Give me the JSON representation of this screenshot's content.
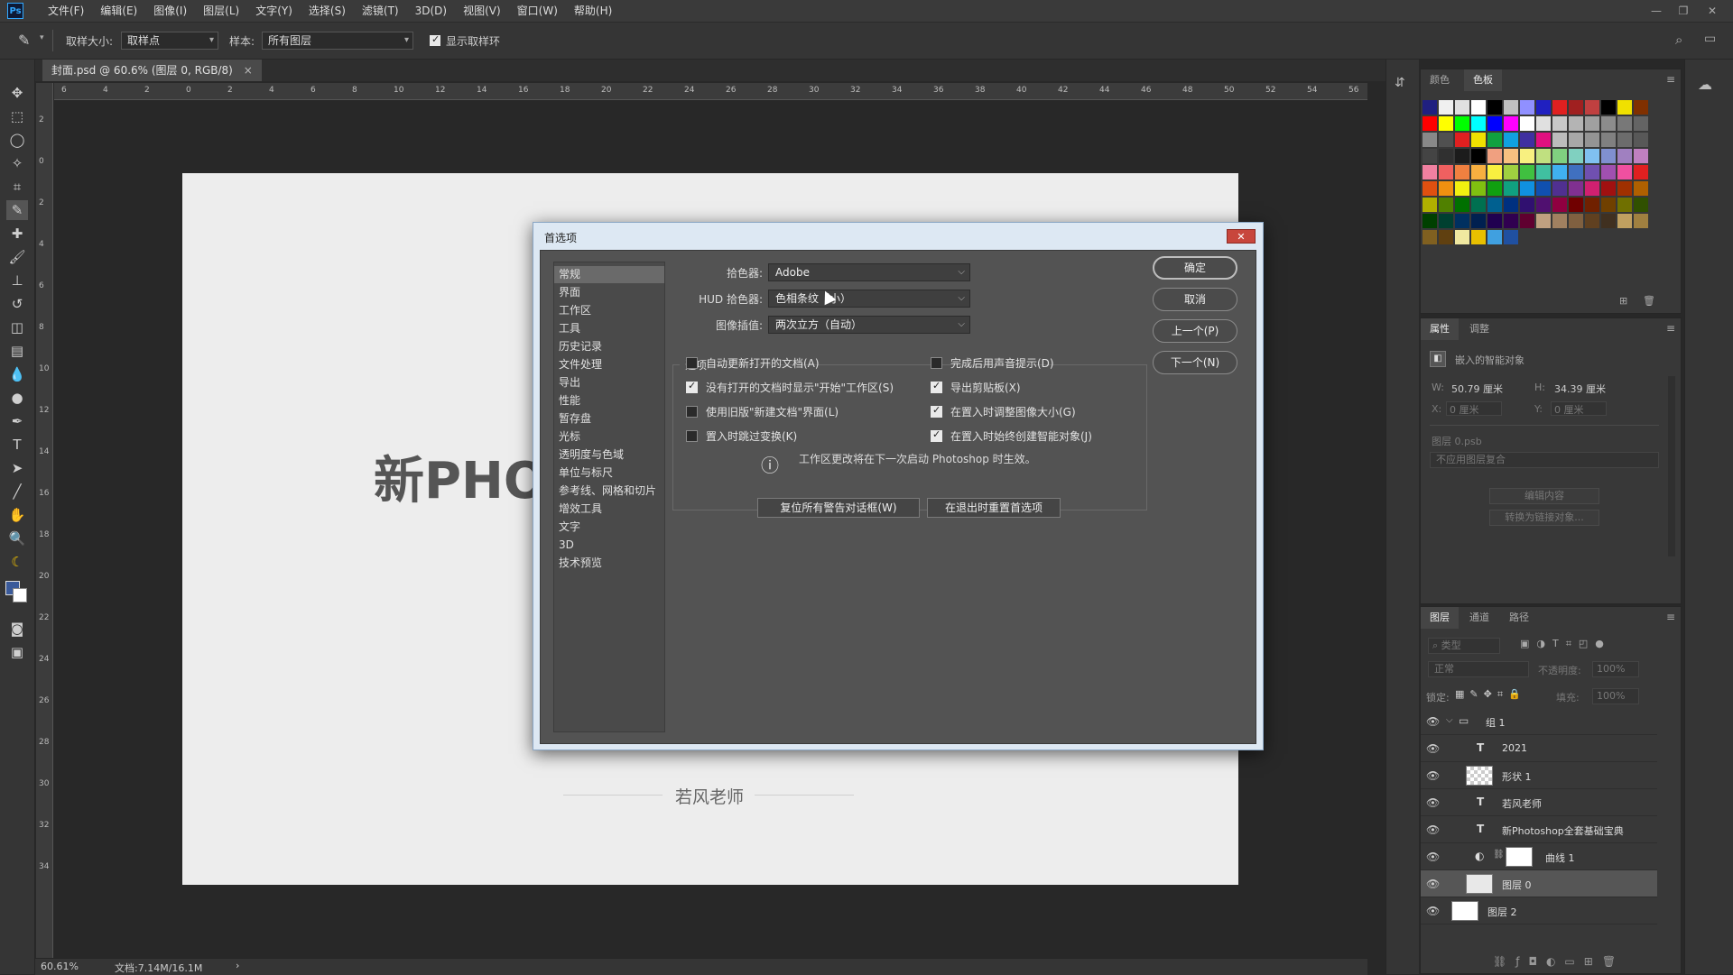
{
  "app": {
    "logo": "Ps",
    "menus": [
      "文件(F)",
      "编辑(E)",
      "图像(I)",
      "图层(L)",
      "文字(Y)",
      "选择(S)",
      "滤镜(T)",
      "3D(D)",
      "视图(V)",
      "窗口(W)",
      "帮助(H)"
    ],
    "window_controls": [
      "minimize-icon",
      "restore-icon",
      "close-icon"
    ]
  },
  "options_bar": {
    "sample_size_label": "取样大小:",
    "sample_size_value": "取样点",
    "sample_label": "样本:",
    "sample_value": "所有图层",
    "show_ring_label": "显示取样环",
    "show_ring_checked": true
  },
  "document": {
    "tab_title": "封面.psd @ 60.6% (图层 0, RGB/8)",
    "tab_close": "×",
    "big_text": "新PHO",
    "signature": "若风老师",
    "hruler_ticks": [
      "6",
      "4",
      "2",
      "0",
      "2",
      "4",
      "6",
      "8",
      "10",
      "12",
      "14",
      "16",
      "18",
      "20",
      "22",
      "24",
      "26",
      "28",
      "30",
      "32",
      "34",
      "36",
      "38",
      "40",
      "42",
      "44",
      "46",
      "48",
      "50",
      "52",
      "54",
      "56"
    ],
    "vruler_ticks": [
      "2",
      "0",
      "2",
      "4",
      "6",
      "8",
      "10",
      "12",
      "14",
      "16",
      "18",
      "20",
      "22",
      "24",
      "26",
      "28",
      "30",
      "32",
      "34"
    ]
  },
  "status": {
    "zoom": "60.61%",
    "doc_info": "文档:7.14M/16.1M",
    "arrow": "›"
  },
  "dialog": {
    "title": "首选项",
    "close": "✕",
    "categories": [
      "常规",
      "界面",
      "工作区",
      "工具",
      "历史记录",
      "文件处理",
      "导出",
      "性能",
      "暂存盘",
      "光标",
      "透明度与色域",
      "单位与标尺",
      "参考线、网格和切片",
      "增效工具",
      "文字",
      "3D",
      "技术预览"
    ],
    "selected_category": "常规",
    "color_picker_label": "拾色器:",
    "color_picker_value": "Adobe",
    "hud_label": "HUD 拾色器:",
    "hud_value": "色相条纹（小）",
    "interp_label": "图像插值:",
    "interp_value": "两次立方（自动）",
    "options_legend": "选项",
    "options": [
      {
        "label": "自动更新打开的文档(A)",
        "checked": false
      },
      {
        "label": "完成后用声音提示(D)",
        "checked": false
      },
      {
        "label": "没有打开的文档时显示\"开始\"工作区(S)",
        "checked": true
      },
      {
        "label": "导出剪贴板(X)",
        "checked": true
      },
      {
        "label": "使用旧版\"新建文档\"界面(L)",
        "checked": false
      },
      {
        "label": "在置入时调整图像大小(G)",
        "checked": true
      },
      {
        "label": "置入时跳过变换(K)",
        "checked": false
      },
      {
        "label": "在置入时始终创建智能对象(J)",
        "checked": true
      }
    ],
    "info_icon": "ⓘ",
    "info_text": "工作区更改将在下一次启动 Photoshop 时生效。",
    "reset_warnings": "复位所有警告对话框(W)",
    "reset_prefs": "在退出时重置首选项",
    "ok": "确定",
    "cancel": "取消",
    "prev": "上一个(P)",
    "next": "下一个(N)"
  },
  "swatches_panel": {
    "tabs": [
      "颜色",
      "色板"
    ],
    "active": "色板",
    "colors": [
      "#202080",
      "#f0f0f0",
      "#e0e0e0",
      "#ffffff",
      "#000000",
      "#c0c0c0",
      "#9090ff",
      "#2020c0",
      "#e02020",
      "#a02020",
      "#c04040",
      "#000000",
      "#f0e000",
      "#803000",
      "#ff0000",
      "#ffff00",
      "#00ff00",
      "#00ffff",
      "#0000ff",
      "#ff00ff",
      "#ffffff",
      "#e0e0e0",
      "#c8c8c8",
      "#b4b4b4",
      "#a0a0a0",
      "#8c8c8c",
      "#787878",
      "#646464",
      "#888888",
      "#505050",
      "#e02020",
      "#f0e000",
      "#10a040",
      "#10a0e0",
      "#4030a0",
      "#e01080",
      "#bcbcbc",
      "#a8a8a8",
      "#949494",
      "#808080",
      "#6c6c6c",
      "#585858",
      "#444444",
      "#303030",
      "#1c1c1c",
      "#000000",
      "#f0a080",
      "#f8c080",
      "#f8f080",
      "#c0e080",
      "#80d080",
      "#80d0c0",
      "#80c0f0",
      "#8090d0",
      "#a080c0",
      "#c080c0",
      "#f080a0",
      "#f06060",
      "#f08040",
      "#f8b040",
      "#f8f040",
      "#a0d040",
      "#40c040",
      "#40c0a0",
      "#40b0f0",
      "#4070c0",
      "#7050b0",
      "#a050b0",
      "#f050a0",
      "#e02020",
      "#e05010",
      "#f09010",
      "#f0f010",
      "#80c010",
      "#10a010",
      "#10a080",
      "#1090e0",
      "#1050b0",
      "#503090",
      "#803090",
      "#d02070",
      "#a01010",
      "#a03000",
      "#b06000",
      "#b0b000",
      "#508000",
      "#007000",
      "#007050",
      "#006090",
      "#003080",
      "#301070",
      "#501070",
      "#900040",
      "#700000",
      "#702000",
      "#704000",
      "#707000",
      "#305000",
      "#004000",
      "#004030",
      "#003060",
      "#002050",
      "#200050",
      "#300050",
      "#600030",
      "#c0a080",
      "#a08060",
      "#806040",
      "#604020",
      "#403020",
      "#c0a060",
      "#a08040",
      "#806020",
      "#604010",
      "#f0e8a0",
      "#e8c000",
      "#40a0e0",
      "#2050a0"
    ]
  },
  "properties_panel": {
    "tabs": [
      "属性",
      "调整"
    ],
    "active": "属性",
    "type_label": "嵌入的智能对象",
    "w_label": "W:",
    "w_value": "50.79 厘米",
    "h_label": "H:",
    "h_value": "34.39 厘米",
    "x_label": "X:",
    "x_value": "0 厘米",
    "y_label": "Y:",
    "y_value": "0 厘米",
    "file_name": "图层 0.psb",
    "comp_value": "不应用图层复合",
    "edit_btn": "编辑内容",
    "convert_btn": "转换为链接对象..."
  },
  "layers_panel": {
    "tabs": [
      "图层",
      "通道",
      "路径"
    ],
    "active": "图层",
    "filter_placeholder": "类型",
    "blend_mode": "正常",
    "opacity_label": "不透明度:",
    "opacity_value": "100%",
    "lock_label": "锁定:",
    "fill_label": "填充:",
    "fill_value": "100%",
    "layers": [
      {
        "name": "组 1",
        "kind": "group"
      },
      {
        "name": "2021",
        "kind": "text"
      },
      {
        "name": "形状 1",
        "kind": "shape"
      },
      {
        "name": "若风老师",
        "kind": "text"
      },
      {
        "name": "新Photoshop全套基础宝典",
        "kind": "text"
      },
      {
        "name": "曲线 1",
        "kind": "adjustment"
      },
      {
        "name": "图层 0",
        "kind": "smart",
        "selected": true
      },
      {
        "name": "图层 2",
        "kind": "pixel"
      }
    ]
  }
}
